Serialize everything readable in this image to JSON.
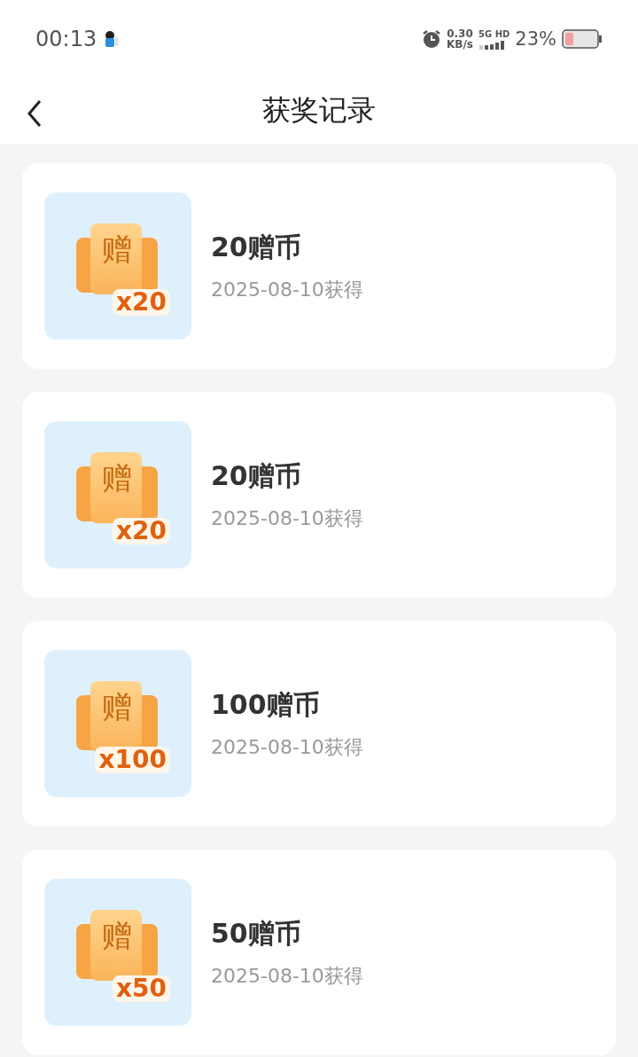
{
  "status_bar": {
    "time": "00:13",
    "speed_value": "0.30",
    "speed_unit": "KB/s",
    "network_top": "5G HD",
    "battery": "23%"
  },
  "header": {
    "title": "获奖记录"
  },
  "records": [
    {
      "icon_char": "赠",
      "icon_count": "x20",
      "title": "20赠币",
      "date": "2025-08-10获得"
    },
    {
      "icon_char": "赠",
      "icon_count": "x20",
      "title": "20赠币",
      "date": "2025-08-10获得"
    },
    {
      "icon_char": "赠",
      "icon_count": "x100",
      "title": "100赠币",
      "date": "2025-08-10获得"
    },
    {
      "icon_char": "赠",
      "icon_count": "x50",
      "title": "50赠币",
      "date": "2025-08-10获得"
    }
  ]
}
